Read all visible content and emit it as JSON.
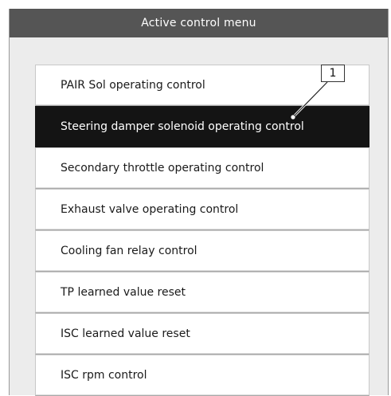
{
  "window": {
    "title": "Active control menu"
  },
  "menu": {
    "items": [
      {
        "label": "PAIR Sol operating control"
      },
      {
        "label": "Steering damper solenoid operating control"
      },
      {
        "label": "Secondary throttle operating control"
      },
      {
        "label": "Exhaust valve operating control"
      },
      {
        "label": "Cooling fan relay control"
      },
      {
        "label": "TP learned value reset"
      },
      {
        "label": "ISC learned value reset"
      },
      {
        "label": "ISC rpm control"
      }
    ],
    "selected_index": 1
  },
  "callout": {
    "label": "1"
  },
  "colors": {
    "title_bar": "#555555",
    "selected_bg": "#141414",
    "window_bg": "#ececec"
  }
}
